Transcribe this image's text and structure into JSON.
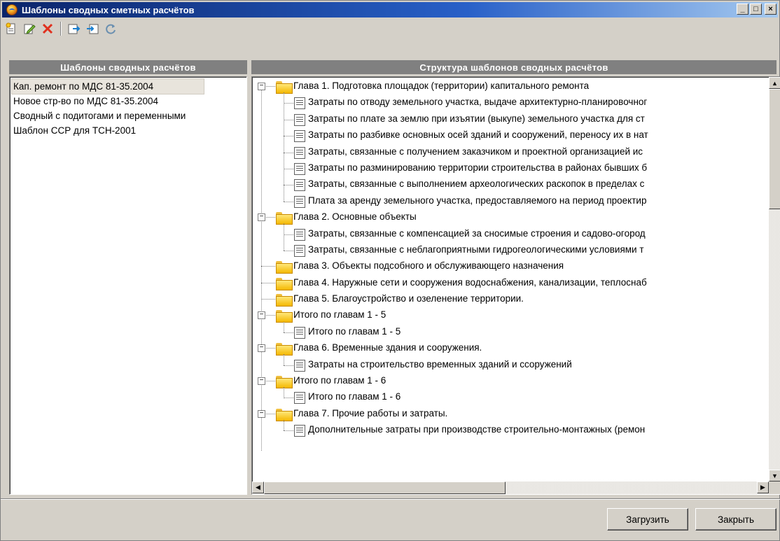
{
  "window": {
    "title": "Шаблоны сводных сметных расчётов"
  },
  "titlebar_buttons": {
    "minimize": "_",
    "maximize": "□",
    "close": "×"
  },
  "toolbar": [
    {
      "name": "new-template-icon"
    },
    {
      "name": "edit-template-icon"
    },
    {
      "name": "delete-template-icon"
    },
    {
      "name": "export-icon"
    },
    {
      "name": "import-icon"
    },
    {
      "name": "refresh-icon"
    }
  ],
  "left_panel": {
    "header": "Шаблоны сводных расчётов",
    "items": [
      {
        "label": "Кап. ремонт по МДС 81-35.2004",
        "selected": true
      },
      {
        "label": "Новое стр-во по МДС 81-35.2004",
        "selected": false
      },
      {
        "label": "Сводный с подитогами и переменными",
        "selected": false
      },
      {
        "label": "Шаблон ССР для ТСН-2001",
        "selected": false
      }
    ]
  },
  "right_panel": {
    "header": "Структура шаблонов сводных расчётов",
    "tree": [
      {
        "type": "folder",
        "label": "Глава  1. Подготовка площадок (территории) капитального ремонта",
        "expanded": true,
        "children": [
          "Затраты по отводу земельного участка, выдаче архитектурно-планировочног",
          "Затраты по плате за землю при изъятии (выкупе) земельного участка для ст",
          "Затраты по разбивке основных осей зданий и сооружений, переносу их в нат",
          "Затраты, связанные с получением заказчиком и проектной организацией ис",
          "Затраты по разминированию территории строительства в районах бывших б",
          "Затраты, связанные с выполнением археологических раскопок в пределах с",
          "Плата за аренду земельного участка, предоставляемого на период проектир"
        ]
      },
      {
        "type": "folder",
        "label": "Глава  2. Основные объекты",
        "expanded": true,
        "children": [
          "Затраты, связанные с компенсацией за сносимые строения и садово-огород",
          "Затраты, связанные с неблагоприятными гидрогеологическими условиями т"
        ]
      },
      {
        "type": "folder",
        "label": "Глава  3. Объекты подсобного и обслуживающего назначения",
        "expanded": false,
        "children": []
      },
      {
        "type": "folder",
        "label": "Глава  4. Наружные сети и сооружения водоснабжения, канализации, теплоснаб",
        "expanded": false,
        "children": []
      },
      {
        "type": "folder",
        "label": "Глава  5. Благоустройство и озеленение территории.",
        "expanded": false,
        "children": []
      },
      {
        "type": "folder",
        "label": "Итого по главам 1 - 5",
        "expanded": true,
        "children": [
          "Итого по главам 1 - 5"
        ]
      },
      {
        "type": "folder",
        "label": "Глава  6. Временные здания и сооружения.",
        "expanded": true,
        "children": [
          "Затраты на строительство временных зданий и ссоружений"
        ]
      },
      {
        "type": "folder",
        "label": "Итого по главам 1 - 6",
        "expanded": true,
        "children": [
          "Итого по главам 1 - 6"
        ]
      },
      {
        "type": "folder",
        "label": "Глава  7. Прочие работы и затраты.",
        "expanded": true,
        "children": [
          "Дополнительные затраты при производстве строительно-монтажных (ремон"
        ]
      }
    ]
  },
  "buttons": {
    "load": "Загрузить",
    "close": "Закрыть"
  }
}
